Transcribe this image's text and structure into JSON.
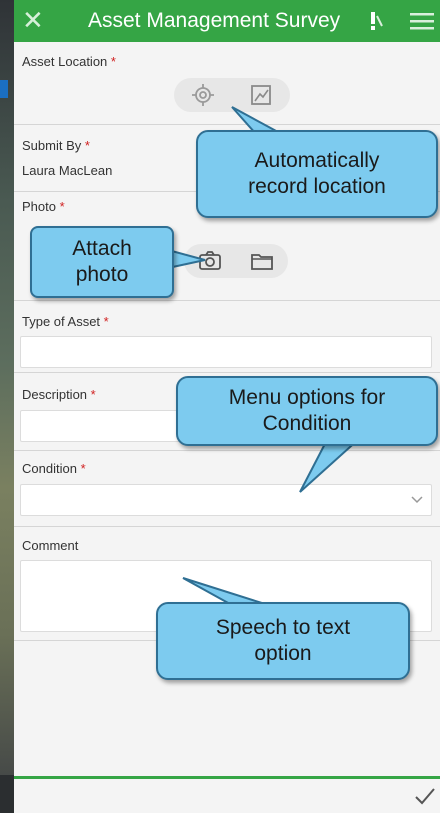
{
  "header": {
    "title": "Asset Management Survey",
    "close_icon": "close-icon",
    "alert_icon": "alert-icon",
    "menu_icon": "menu-icon",
    "color": "#35a545"
  },
  "fields": {
    "asset_location": {
      "label": "Asset Location",
      "required_mark": "*"
    },
    "submit_by": {
      "label": "Submit By",
      "required_mark": "*",
      "value": "Laura MacLean"
    },
    "photo": {
      "label": "Photo",
      "required_mark": "*"
    },
    "type_of_asset": {
      "label": "Type of Asset",
      "required_mark": "*",
      "value": ""
    },
    "description": {
      "label": "Description",
      "required_mark": "*",
      "value": ""
    },
    "condition": {
      "label": "Condition",
      "required_mark": "*",
      "value": ""
    },
    "comment": {
      "label": "Comment",
      "value": ""
    }
  },
  "callouts": {
    "location": [
      "Automatically",
      "record location"
    ],
    "photo": [
      "Attach",
      "photo"
    ],
    "condition": [
      "Menu options for",
      "Condition"
    ],
    "speech": [
      "Speech to text",
      "option"
    ]
  },
  "callout_color": "#7dcbef",
  "footer": {
    "submit_icon": "checkmark-icon"
  }
}
